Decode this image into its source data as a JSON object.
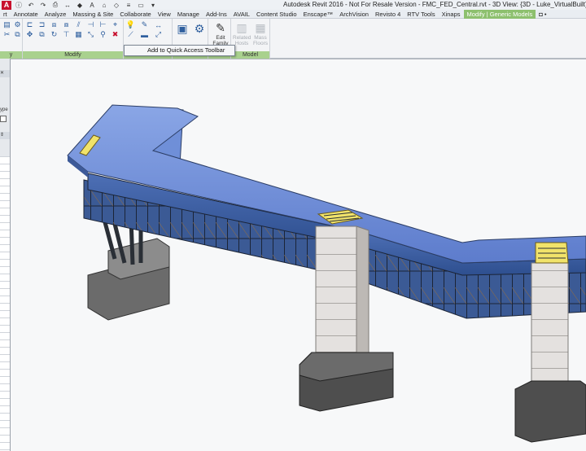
{
  "app": {
    "logo": "A",
    "title": "Autodesk Revit 2016 -  Not For Resale Version -    FMC_FED_Central.rvt - 3D View: {3D - Luke_VirtualBuilt}"
  },
  "quick_access": {
    "icons": [
      "info-icon",
      "undo-icon",
      "redo-icon",
      "print-icon",
      "measure-icon",
      "tag-icon",
      "text-icon",
      "3d-view-icon",
      "section-icon",
      "thin-lines-icon",
      "close-hidden-icon",
      "switch-windows-icon"
    ]
  },
  "tabs": [
    {
      "label": "rt"
    },
    {
      "label": "Annotate"
    },
    {
      "label": "Analyze"
    },
    {
      "label": "Massing & Site"
    },
    {
      "label": "Collaborate"
    },
    {
      "label": "View"
    },
    {
      "label": "Manage"
    },
    {
      "label": "Add-Ins"
    },
    {
      "label": "AVAIL"
    },
    {
      "label": "Content Studio"
    },
    {
      "label": "Enscape™"
    },
    {
      "label": "ArchVision"
    },
    {
      "label": "Revisto 4"
    },
    {
      "label": "RTV Tools"
    },
    {
      "label": "Xinaps"
    },
    {
      "label": "Modify | Generic Models"
    },
    {
      "label": "◘ •"
    }
  ],
  "ribbon": {
    "panels": {
      "select_partial": "y",
      "modify": "Modify",
      "model": "Model"
    },
    "buttons": {
      "edit_family_line1": "Edit",
      "edit_family_line2": "Family",
      "related_hosts_line1": "Related",
      "related_hosts_line2": "Hosts",
      "mass_floors_line1": "Mass",
      "mass_floors_line2": "Floors"
    }
  },
  "context_menu": {
    "item": "Add to Quick Access Toolbar"
  },
  "properties_stub": {
    "type_label": "ype"
  },
  "colors": {
    "accent_tab": "#4ea72e",
    "context_tab": "#8dc06e",
    "deck_blue": "#6f8fd8",
    "steel": "#1f2a3a",
    "concrete": "#c9c9c9",
    "footing": "#555555",
    "highlight_yellow": "#f1e36a"
  }
}
